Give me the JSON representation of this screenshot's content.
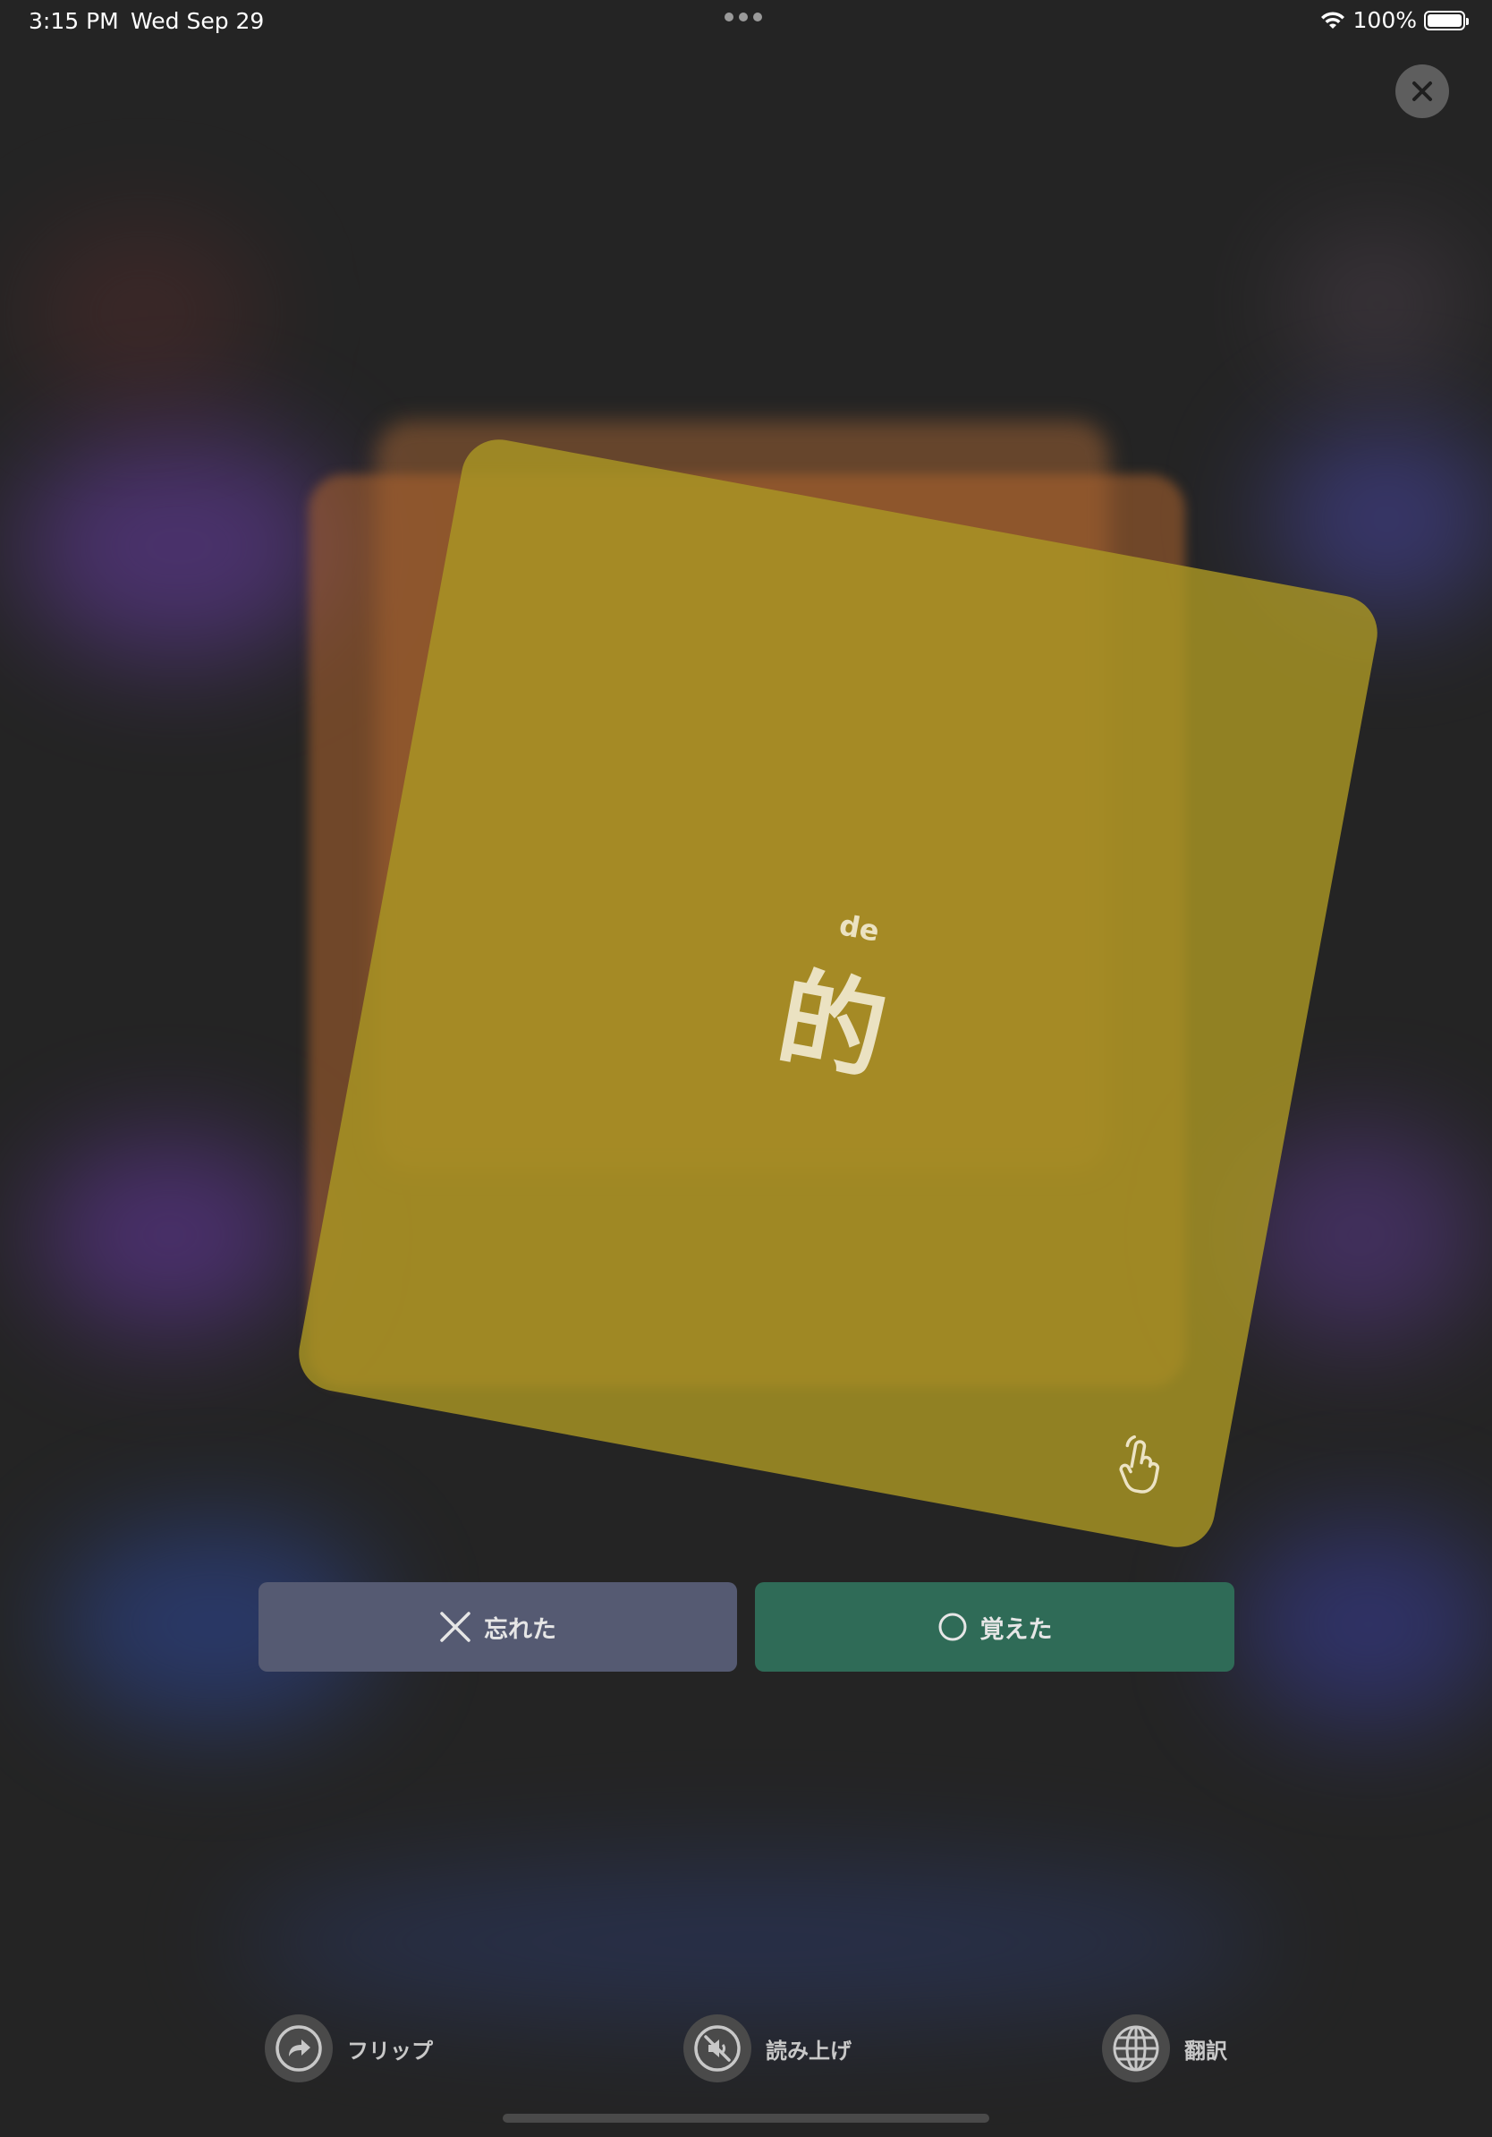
{
  "status_bar": {
    "time": "3:15 PM",
    "date": "Wed Sep 29",
    "battery_percent": "100%",
    "battery_level": 1.0,
    "icons": [
      "multitasking-dots-icon",
      "wifi-icon",
      "battery-icon"
    ]
  },
  "close_button": {
    "icon": "close-icon"
  },
  "card": {
    "pinyin": "de",
    "hanzi": "的",
    "hint_icon": "tap-hand-icon",
    "color": "#aa9623"
  },
  "actions": {
    "forgot_label": "忘れた",
    "forgot_icon": "cross-icon",
    "forgot_color": "#555a72",
    "remembered_label": "覚えた",
    "remembered_icon": "circle-icon",
    "remembered_color": "#2f6b57"
  },
  "toolbar": {
    "flip_label": "フリップ",
    "flip_icon": "flip-arrow-icon",
    "speak_label": "読み上げ",
    "speak_icon": "speaker-muted-icon",
    "translate_label": "翻訳",
    "translate_icon": "globe-icon"
  }
}
